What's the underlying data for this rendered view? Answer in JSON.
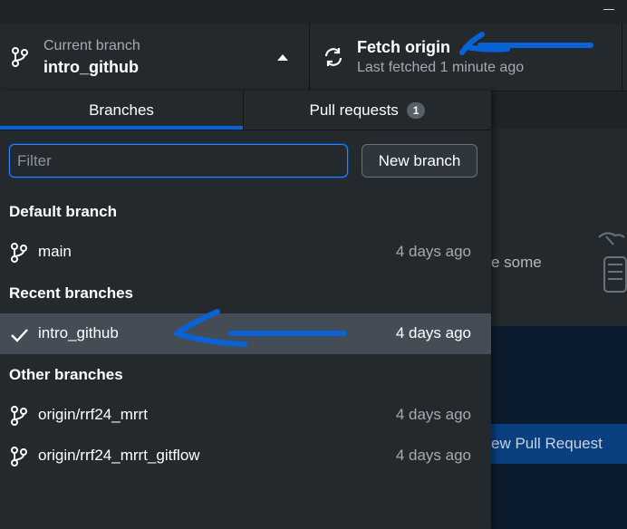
{
  "toolbar": {
    "current_branch_label": "Current branch",
    "current_branch_name": "intro_github",
    "fetch_title": "Fetch origin",
    "fetch_subtitle": "Last fetched 1 minute ago"
  },
  "tabs": [
    {
      "label": "Branches",
      "selected": true
    },
    {
      "label": "Pull requests",
      "count": "1"
    }
  ],
  "filter": {
    "placeholder": "Filter",
    "value": ""
  },
  "new_branch_label": "New branch",
  "sections": {
    "default": {
      "header": "Default branch",
      "branches": [
        {
          "name": "main",
          "time": "4 days ago",
          "icon": "branch-icon"
        }
      ]
    },
    "recent": {
      "header": "Recent branches",
      "branches": [
        {
          "name": "intro_github",
          "time": "4 days ago",
          "icon": "check-icon",
          "selected": true
        }
      ]
    },
    "other": {
      "header": "Other branches",
      "branches": [
        {
          "name": "origin/rrf24_mrrt",
          "time": "4 days ago",
          "icon": "branch-icon"
        },
        {
          "name": "origin/rrf24_mrrt_gitflow",
          "time": "4 days ago",
          "icon": "branch-icon"
        }
      ]
    }
  },
  "background": {
    "partial_text": "e some",
    "partial_button": "ew Pull Request"
  },
  "colors": {
    "accent": "#0366d6",
    "annotation_arrow": "#0a63d6",
    "selected_row": "#444d56"
  }
}
